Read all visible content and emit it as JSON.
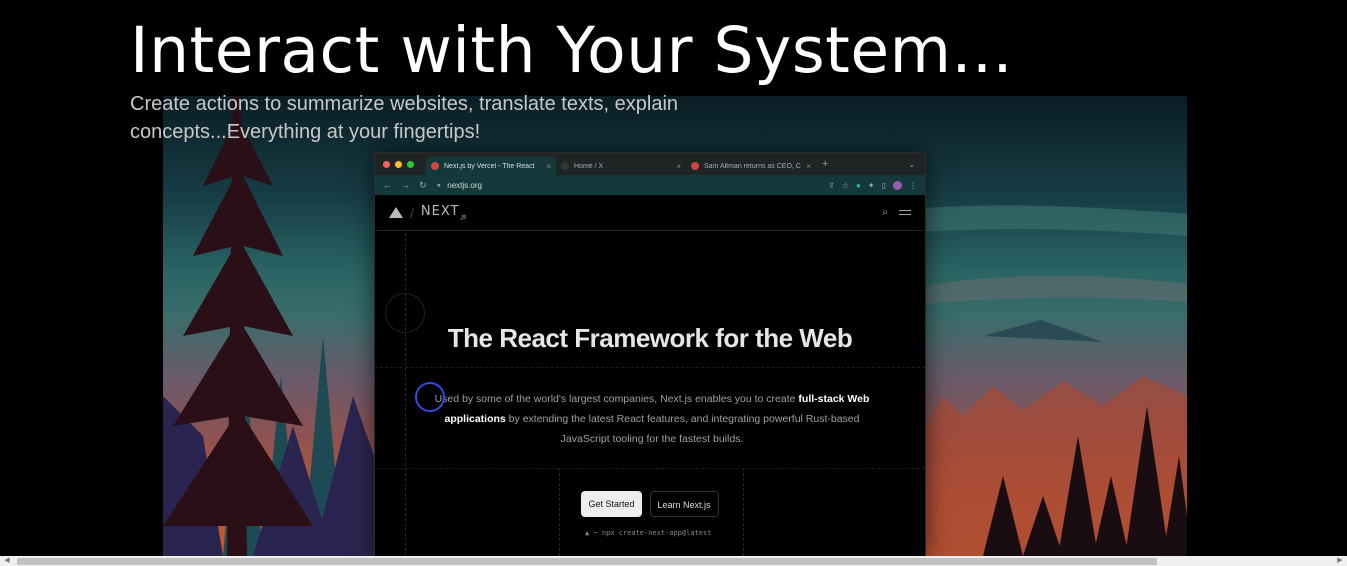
{
  "hero": {
    "title": "Interact with Your System...",
    "subtitle": "Create actions to summarize websites, translate texts, explain concepts...Everything at your fingertips!"
  },
  "browser": {
    "tabs": [
      {
        "label": "Next.js by Vercel - The React",
        "favicon_color": "#d04545",
        "active": true
      },
      {
        "label": "Home / X",
        "favicon_color": "#333333",
        "active": false
      },
      {
        "label": "Sam Altman returns as CEO, C",
        "favicon_color": "#cc4444",
        "active": false
      }
    ],
    "url": "nextjs.org",
    "traffic_lights": [
      "#ff5f57",
      "#febc2e",
      "#28c840"
    ]
  },
  "site": {
    "logo": "NEXT",
    "logo_suffix": ".js",
    "headline": "The React Framework for the Web",
    "desc_part1": "Used by some of the world's largest companies, Next.js enables you to create ",
    "desc_bold": "full-stack Web applications",
    "desc_part2": " by extending the latest React features, and integrating powerful Rust-based JavaScript tooling for the fastest builds.",
    "primary_button": "Get Started",
    "secondary_button": "Learn Next.js",
    "command": "▲ ~ npx create-next-app@latest"
  },
  "colors": {
    "cursor_ring": "#2f4bd9",
    "background": "#000000"
  }
}
